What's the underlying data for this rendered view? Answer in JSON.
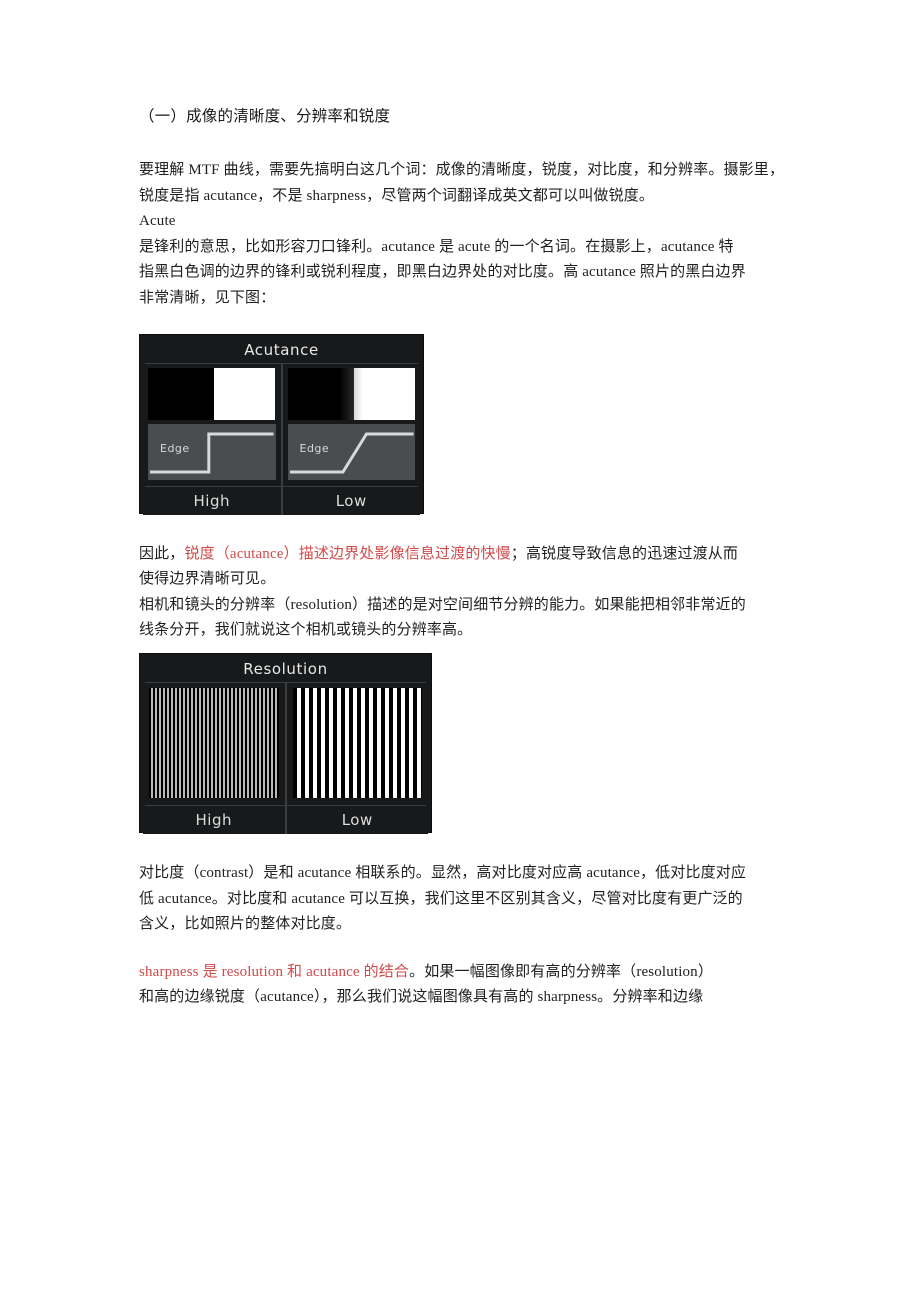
{
  "document": {
    "heading": "（一）成像的清晰度、分辨率和锐度",
    "paragraphs": {
      "p1_line1": "要理解 MTF 曲线，需要先搞明白这几个词：成像的清晰度，锐度，对比度，和分辨率。摄影里，锐度是指 acutance，不是 sharpness，尽管两个词翻译成英文都可以叫做锐度。",
      "p1_line2": "Acute",
      "p1_line3": "是锋利的意思，比如形容刀口锋利。acutance 是 acute 的一个名词。在摄影上，acutance 特",
      "p1_line4": "指黑白色调的边界的锋利或锐利程度，即黑白边界处的对比度。高 acutance 照片的黑白边界",
      "p1_line5": "非常清晰，见下图：",
      "p2_prefix": "因此，",
      "p2_red": "锐度（acutance）描述边界处影像信息过渡的快慢",
      "p2_suffix": "；高锐度导致信息的迅速过渡从而",
      "p2_line2": "使得边界清晰可见。",
      "p3_line1": "相机和镜头的分辨率（resolution）描述的是对空间细节分辨的能力。如果能把相邻非常近的",
      "p3_line2": "线条分开，我们就说这个相机或镜头的分辨率高。",
      "p4_line1": "对比度（contrast）是和 acutance 相联系的。显然，高对比度对应高 acutance，低对比度对应",
      "p4_line2": "低 acutance。对比度和 acutance 可以互换，我们这里不区别其含义，尽管对比度有更广泛的",
      "p4_line3": "含义，比如照片的整体对比度。",
      "p5_red": "sharpness 是 resolution 和 acutance 的结合",
      "p5_suffix": "。如果一幅图像即有高的分辨率（resolution）",
      "p5_line2": "和高的边缘锐度（acutance），那么我们说这幅图像具有高的 sharpness。分辨率和边缘"
    }
  },
  "figures": {
    "acutance": {
      "title": "Acutance",
      "edge_label_left": "Edge",
      "edge_label_right": "Edge",
      "foot_left": "High",
      "foot_right": "Low"
    },
    "resolution": {
      "title": "Resolution",
      "foot_left": "High",
      "foot_right": "Low"
    }
  },
  "colors": {
    "highlight_red": "#d14a4a",
    "figure_background": "#17191a",
    "figure_panel": "#4a4d4f",
    "text": "#1f1f1f",
    "page": "#ffffff"
  }
}
